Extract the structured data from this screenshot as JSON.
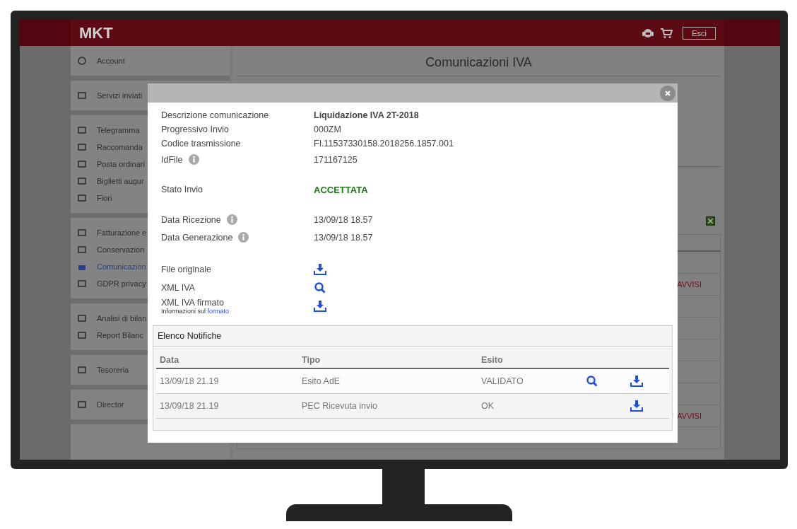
{
  "header": {
    "logo": "MKT",
    "exit_button": "Esci"
  },
  "sidebar": [
    {
      "items": [
        {
          "label": "Account",
          "selected": false
        }
      ]
    },
    {
      "items": [
        {
          "label": "Servizi inviati",
          "selected": false
        }
      ]
    },
    {
      "items": [
        {
          "label": "Telegramma",
          "selected": false
        },
        {
          "label": "Raccomanda",
          "selected": false
        },
        {
          "label": "Posta ordinari",
          "selected": false
        },
        {
          "label": "Biglietti augur",
          "selected": false
        },
        {
          "label": "Fiori",
          "selected": false
        }
      ]
    },
    {
      "items": [
        {
          "label": "Fatturazione e",
          "selected": false
        },
        {
          "label": "Conservazion",
          "selected": false
        },
        {
          "label": "Comunicazion",
          "selected": true
        },
        {
          "label": "GDPR privacy",
          "selected": false
        }
      ]
    },
    {
      "items": [
        {
          "label": "Analisi di bilan",
          "selected": false
        },
        {
          "label": "Report Bilanc",
          "selected": false
        }
      ]
    },
    {
      "items": [
        {
          "label": "Tesoreria",
          "selected": false
        }
      ]
    },
    {
      "items": [
        {
          "label": "Director",
          "selected": false
        }
      ]
    }
  ],
  "page_title": "Comunicazioni IVA",
  "background_rows": [
    {
      "kind": "plain"
    },
    {
      "kind": "note",
      "text": "AVVISI"
    },
    {
      "kind": "plain"
    },
    {
      "kind": "plain"
    },
    {
      "kind": "plain"
    },
    {
      "kind": "plain"
    },
    {
      "kind": "plain"
    },
    {
      "kind": "note",
      "text": "AVVISI"
    },
    {
      "kind": "plain"
    }
  ],
  "modal": {
    "sections": [
      [
        {
          "label": "Descrizione comunicazione",
          "value": "Liquidazione IVA 2T-2018",
          "kind": "title",
          "info": false
        },
        {
          "label": "Progressivo Invio",
          "value": "000ZM",
          "kind": "text",
          "info": false
        },
        {
          "label": "Codice trasmissione",
          "value": "FI.11537330158.2018256.1857.001",
          "kind": "text",
          "info": false
        },
        {
          "label": "IdFile",
          "value": "171167125",
          "kind": "text",
          "info": true
        }
      ],
      [
        {
          "label": "Stato Invio",
          "value": "ACCETTATA",
          "kind": "status",
          "info": false
        }
      ],
      [
        {
          "label": "Data Ricezione",
          "value": "13/09/18 18.57",
          "kind": "text",
          "info": true
        },
        {
          "label": "Data Generazione",
          "value": "13/09/18 18.57",
          "kind": "text",
          "info": true
        }
      ]
    ],
    "files": [
      {
        "label": "File originale",
        "kind": "download"
      },
      {
        "label": "XML IVA",
        "kind": "view"
      },
      {
        "label": "XML IVA firmato",
        "kind": "download",
        "note": "Informazioni sul",
        "link": "formato"
      }
    ],
    "notifications": {
      "title": "Elenco Notifiche",
      "columns": [
        "Data",
        "Tipo",
        "Esito"
      ],
      "rows": [
        {
          "date": "13/09/18 21.19",
          "type": "Esito AdE",
          "outcome": "VALIDATO",
          "view": true,
          "download": true
        },
        {
          "date": "13/09/18 21.19",
          "type": "PEC Ricevuta invio",
          "outcome": "OK",
          "view": false,
          "download": true
        }
      ]
    }
  }
}
